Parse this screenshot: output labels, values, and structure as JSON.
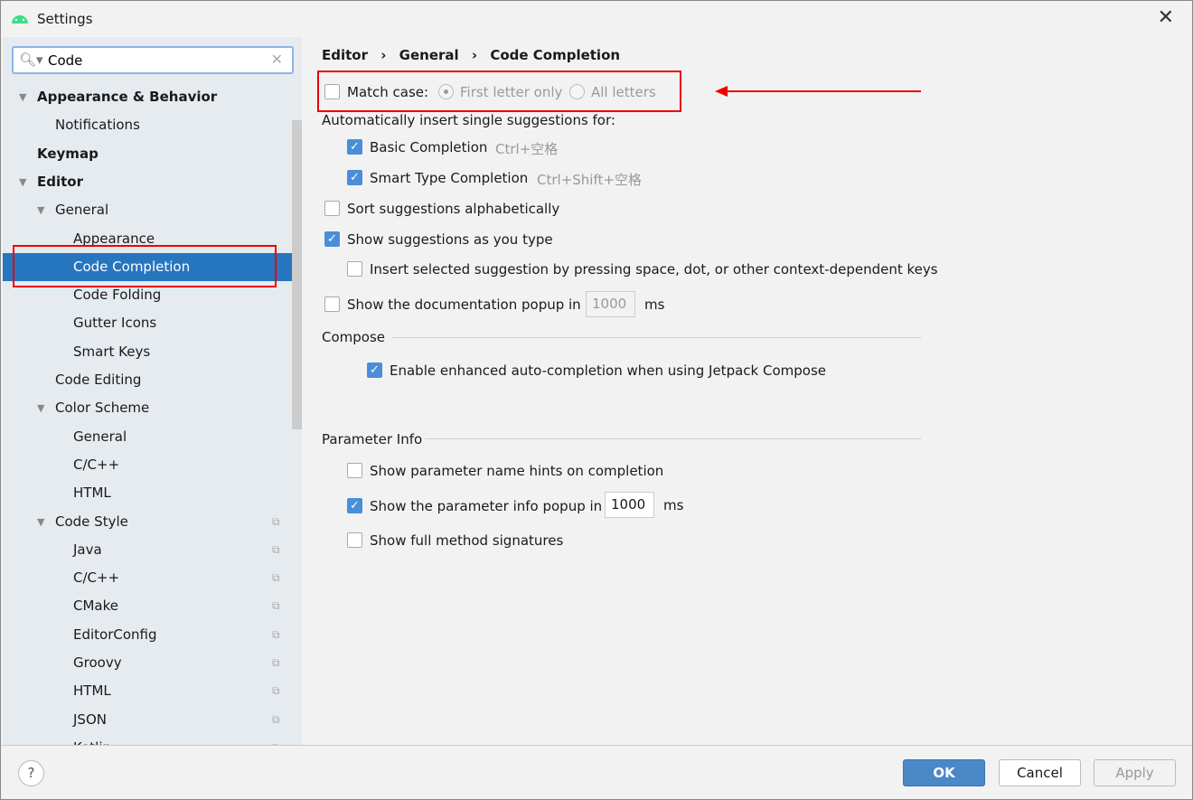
{
  "window": {
    "title": "Settings",
    "close_icon": "close-icon"
  },
  "search": {
    "value": "Code"
  },
  "tree": [
    {
      "label": "Appearance & Behavior",
      "level": 0,
      "bold": true,
      "expanded": true
    },
    {
      "label": "Notifications",
      "level": 1
    },
    {
      "label": "Keymap",
      "level": 0,
      "bold": true
    },
    {
      "label": "Editor",
      "level": 0,
      "bold": true,
      "expanded": true
    },
    {
      "label": "General",
      "level": 1,
      "expanded": true
    },
    {
      "label": "Appearance",
      "level": 2
    },
    {
      "label": "Code Completion",
      "level": 2,
      "selected": true
    },
    {
      "label": "Code Folding",
      "level": 2
    },
    {
      "label": "Gutter Icons",
      "level": 2
    },
    {
      "label": "Smart Keys",
      "level": 2
    },
    {
      "label": "Code Editing",
      "level": 1
    },
    {
      "label": "Color Scheme",
      "level": 1,
      "expanded": true
    },
    {
      "label": "General",
      "level": 2
    },
    {
      "label": "C/C++",
      "level": 2
    },
    {
      "label": "HTML",
      "level": 2
    },
    {
      "label": "Code Style",
      "level": 1,
      "expanded": true,
      "copy": true
    },
    {
      "label": "Java",
      "level": 2,
      "copy": true
    },
    {
      "label": "C/C++",
      "level": 2,
      "copy": true
    },
    {
      "label": "CMake",
      "level": 2,
      "copy": true
    },
    {
      "label": "EditorConfig",
      "level": 2,
      "copy": true
    },
    {
      "label": "Groovy",
      "level": 2,
      "copy": true
    },
    {
      "label": "HTML",
      "level": 2,
      "copy": true
    },
    {
      "label": "JSON",
      "level": 2,
      "copy": true
    },
    {
      "label": "Kotlin",
      "level": 2,
      "copy": true
    }
  ],
  "breadcrumb": [
    "Editor",
    "General",
    "Code Completion"
  ],
  "main": {
    "match_case": "Match case:",
    "first_letter": "First letter only",
    "all_letters": "All letters",
    "auto_insert": "Automatically insert single suggestions for:",
    "basic": "Basic Completion",
    "basic_key": "Ctrl+空格",
    "smart": "Smart Type Completion",
    "smart_key": "Ctrl+Shift+空格",
    "sort": "Sort suggestions alphabetically",
    "show_typing": "Show suggestions as you type",
    "insert_selected": "Insert selected suggestion by pressing space, dot, or other context-dependent keys",
    "doc_popup": "Show the documentation popup in",
    "doc_ms": "1000",
    "ms": "ms",
    "compose": "Compose",
    "compose_enhanced": "Enable enhanced auto-completion when using Jetpack Compose",
    "param_info": "Parameter Info",
    "param_hints": "Show parameter name hints on completion",
    "param_popup": "Show the parameter info popup in",
    "param_ms": "1000",
    "full_sig": "Show full method signatures"
  },
  "footer": {
    "help": "?",
    "ok": "OK",
    "cancel": "Cancel",
    "apply": "Apply"
  },
  "colors": {
    "accent": "#2675bf",
    "annotation": "#e00000"
  }
}
